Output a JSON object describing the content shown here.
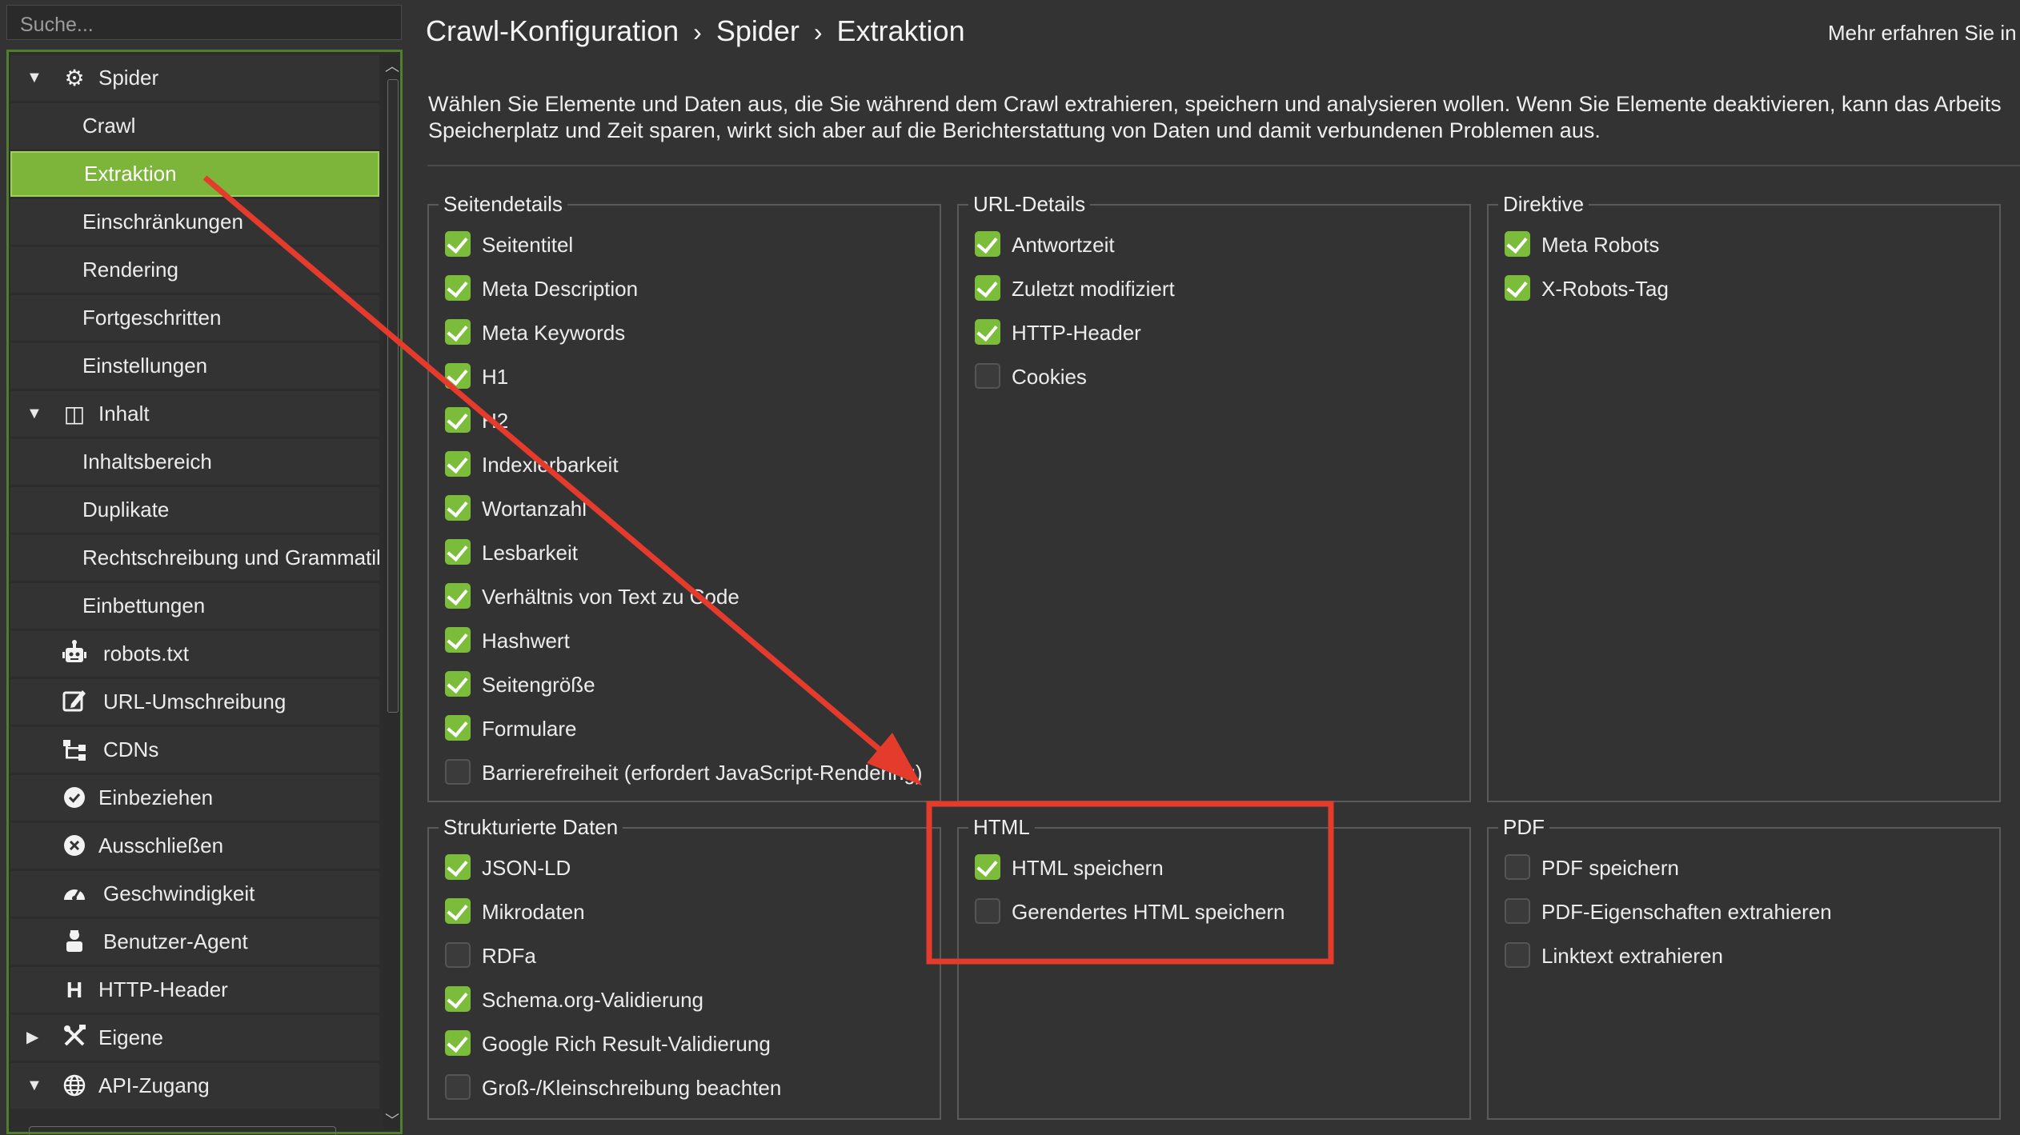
{
  "search": {
    "placeholder": "Suche..."
  },
  "sidebar": {
    "items": [
      {
        "label": "Spider",
        "icon": "gear-icon"
      },
      {
        "label": "Crawl"
      },
      {
        "label": "Extraktion"
      },
      {
        "label": "Einschränkungen"
      },
      {
        "label": "Rendering"
      },
      {
        "label": "Fortgeschritten"
      },
      {
        "label": "Einstellungen"
      },
      {
        "label": "Inhalt",
        "icon": "layout-icon"
      },
      {
        "label": "Inhaltsbereich"
      },
      {
        "label": "Duplikate"
      },
      {
        "label": "Rechtschreibung und Grammatik"
      },
      {
        "label": "Einbettungen"
      },
      {
        "label": "robots.txt",
        "icon": "robot-icon"
      },
      {
        "label": "URL-Umschreibung",
        "icon": "edit-icon"
      },
      {
        "label": "CDNs",
        "icon": "sitemap-icon"
      },
      {
        "label": "Einbeziehen",
        "icon": "check-circle-icon"
      },
      {
        "label": "Ausschließen",
        "icon": "x-circle-icon"
      },
      {
        "label": "Geschwindigkeit",
        "icon": "speedometer-icon"
      },
      {
        "label": "Benutzer-Agent",
        "icon": "user-agent-icon"
      },
      {
        "label": "HTTP-Header",
        "icon": "header-icon"
      },
      {
        "label": "Eigene",
        "icon": "tools-icon"
      },
      {
        "label": "API-Zugang",
        "icon": "globe-icon"
      }
    ]
  },
  "header": {
    "breadcrumb": [
      "Crawl-Konfiguration",
      "Spider",
      "Extraktion"
    ],
    "separator": "›",
    "learn_more": "Mehr erfahren Sie in"
  },
  "description": {
    "line1": "Wählen Sie Elemente und Daten aus, die Sie während dem Crawl extrahieren, speichern und analysieren wollen. Wenn Sie Elemente deaktivieren, kann das Arbeits",
    "line2": "Speicherplatz und Zeit sparen, wirkt sich aber auf die Berichterstattung von Daten und damit verbundenen Problemen aus."
  },
  "groups": {
    "seitendetails": {
      "title": "Seitendetails",
      "items": [
        {
          "label": "Seitentitel",
          "checked": true
        },
        {
          "label": "Meta Description",
          "checked": true
        },
        {
          "label": "Meta Keywords",
          "checked": true
        },
        {
          "label": "H1",
          "checked": true
        },
        {
          "label": "H2",
          "checked": true
        },
        {
          "label": "Indexierbarkeit",
          "checked": true
        },
        {
          "label": "Wortanzahl",
          "checked": true
        },
        {
          "label": "Lesbarkeit",
          "checked": true
        },
        {
          "label": "Verhältnis von Text zu Code",
          "checked": true
        },
        {
          "label": "Hashwert",
          "checked": true
        },
        {
          "label": "Seitengröße",
          "checked": true
        },
        {
          "label": "Formulare",
          "checked": true
        },
        {
          "label": "Barrierefreiheit (erfordert JavaScript-Rendering)",
          "checked": false
        }
      ]
    },
    "url_details": {
      "title": "URL-Details",
      "items": [
        {
          "label": "Antwortzeit",
          "checked": true
        },
        {
          "label": "Zuletzt modifiziert",
          "checked": true
        },
        {
          "label": "HTTP-Header",
          "checked": true
        },
        {
          "label": "Cookies",
          "checked": false
        }
      ]
    },
    "direktive": {
      "title": "Direktive",
      "items": [
        {
          "label": "Meta Robots",
          "checked": true
        },
        {
          "label": "X-Robots-Tag",
          "checked": true
        }
      ]
    },
    "strukturierte_daten": {
      "title": "Strukturierte Daten",
      "items": [
        {
          "label": "JSON-LD",
          "checked": true
        },
        {
          "label": "Mikrodaten",
          "checked": true
        },
        {
          "label": "RDFa",
          "checked": false
        },
        {
          "label": "Schema.org-Validierung",
          "checked": true
        },
        {
          "label": "Google Rich Result-Validierung",
          "checked": true
        },
        {
          "label": "Groß-/Kleinschreibung beachten",
          "checked": false
        }
      ]
    },
    "html": {
      "title": "HTML",
      "items": [
        {
          "label": "HTML speichern",
          "checked": true
        },
        {
          "label": "Gerendertes HTML speichern",
          "checked": false
        }
      ]
    },
    "pdf": {
      "title": "PDF",
      "items": [
        {
          "label": "PDF speichern",
          "checked": false
        },
        {
          "label": "PDF-Eigenschaften extrahieren",
          "checked": false
        },
        {
          "label": "Linktext extrahieren",
          "checked": false
        }
      ]
    }
  },
  "colors": {
    "background": "#333333",
    "accent": "#7cb53a",
    "checkbox_checked": "#7bbd3a",
    "annotation": "#e53b2c"
  }
}
